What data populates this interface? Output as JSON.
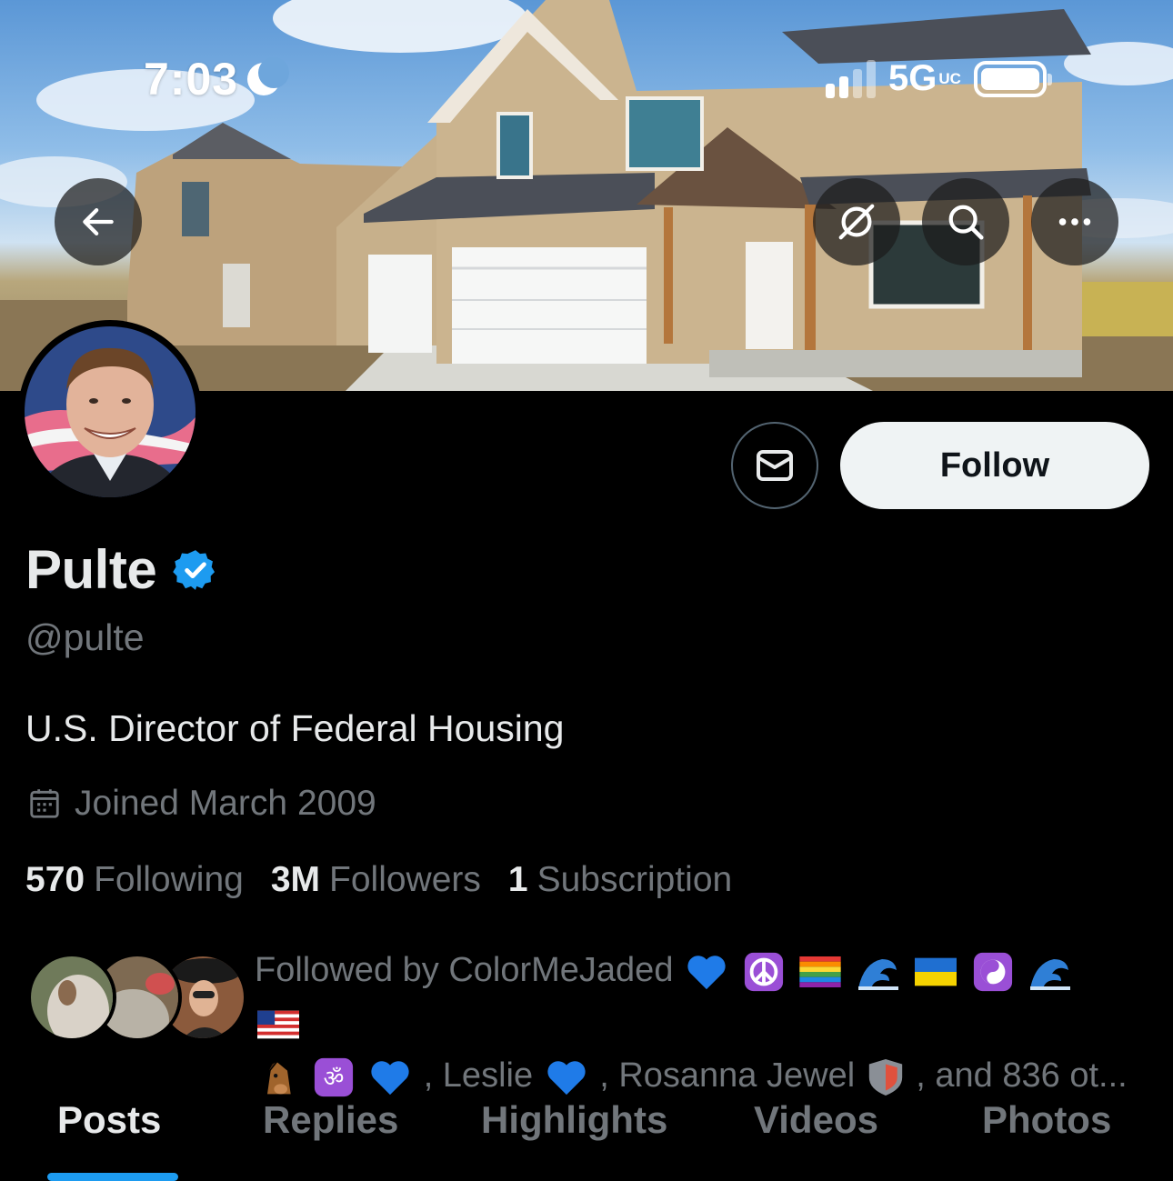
{
  "status_bar": {
    "time": "7:03",
    "network": "5G",
    "network_sub": "UC"
  },
  "profile": {
    "name": "Pulte",
    "handle": "@pulte",
    "bio": "U.S. Director of Federal Housing",
    "joined": "Joined March 2009",
    "verified": true,
    "stats": [
      {
        "value": "570",
        "label": "Following"
      },
      {
        "value": "3M",
        "label": "Followers"
      },
      {
        "value": "1",
        "label": "Subscription"
      }
    ],
    "followed_by": {
      "prefix": "Followed by ColorMeJaded",
      "names": [
        ", Leslie",
        ", Rosanna Jewel",
        ", and 836 ot..."
      ]
    }
  },
  "actions": {
    "follow_label": "Follow"
  },
  "tabs": [
    "Posts",
    "Replies",
    "Highlights",
    "Videos",
    "Photos"
  ],
  "active_tab": "Posts",
  "icons": {
    "back": "arrow-left-icon",
    "grok": "grok-icon",
    "search": "search-icon",
    "more": "more-icon",
    "message": "envelope-icon",
    "calendar": "calendar-icon",
    "verified": "verified-badge-icon"
  },
  "colors": {
    "accent": "#1d9bf0",
    "follow_bg": "#eff3f4",
    "muted": "#71767b",
    "text": "#e7e9ea"
  }
}
